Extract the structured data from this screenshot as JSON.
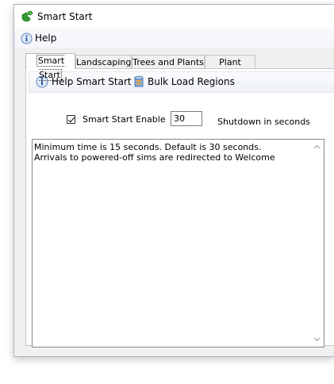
{
  "window": {
    "title": "Smart Start",
    "app_icon": "green-puzzle-icon"
  },
  "menu": {
    "help_label": "Help",
    "help_icon": "info-icon"
  },
  "tabs": [
    {
      "label": "Smart Start",
      "active": true
    },
    {
      "label": "Landscaping",
      "active": false
    },
    {
      "label": "Trees and Plants",
      "active": false
    },
    {
      "label": "Plant Editor",
      "active": false
    }
  ],
  "toolbar": {
    "help_smart_start_label": "Help Smart Start",
    "help_smart_start_icon": "info-icon",
    "bulk_load_label": "Bulk Load Regions",
    "bulk_load_icon": "database-icon"
  },
  "settings": {
    "enable_label": "Smart Start Enable",
    "enable_checked": true,
    "shutdown_value": "30",
    "shutdown_label": "Shutdown in seconds"
  },
  "info_text": {
    "line1": "Minimum time is 15 seconds. Default is 30 seconds.",
    "line2": "Arrivals to powered-off sims are redirected to Welcome"
  }
}
